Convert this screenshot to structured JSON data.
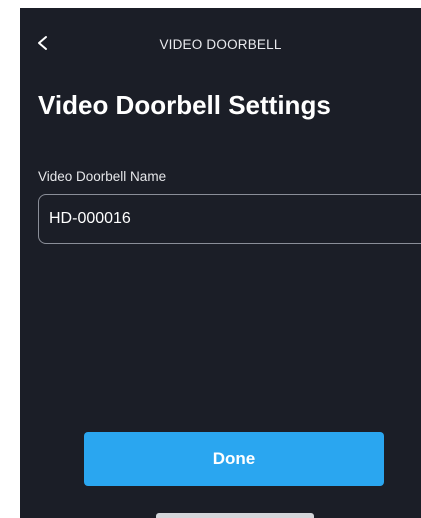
{
  "header": {
    "back_icon": "chevron-left-icon",
    "title": "VIDEO DOORBELL"
  },
  "main": {
    "page_title": "Video Doorbell Settings",
    "name_field": {
      "label": "Video Doorbell Name",
      "value": "HD-000016"
    },
    "done_label": "Done"
  },
  "colors": {
    "background": "#1b1e27",
    "accent": "#2aa6f0",
    "field_border": "#8a8e98"
  }
}
